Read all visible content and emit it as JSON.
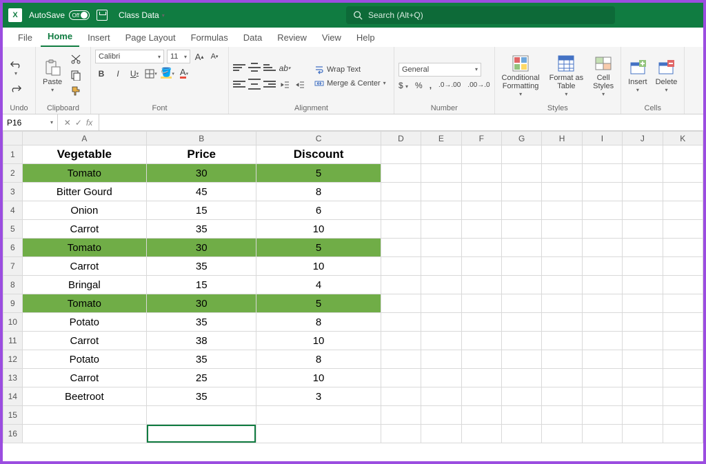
{
  "titlebar": {
    "autosave_label": "AutoSave",
    "autosave_state": "Off",
    "filename": "Class Data",
    "search_placeholder": "Search (Alt+Q)"
  },
  "menu": {
    "tabs": [
      "File",
      "Home",
      "Insert",
      "Page Layout",
      "Formulas",
      "Data",
      "Review",
      "View",
      "Help"
    ],
    "active_index": 1
  },
  "ribbon": {
    "groups": {
      "undo": "Undo",
      "clipboard": "Clipboard",
      "font": "Font",
      "alignment": "Alignment",
      "number": "Number",
      "styles": "Styles",
      "cells": "Cells"
    },
    "clipboard": {
      "paste": "Paste"
    },
    "font": {
      "name": "Calibri",
      "size": "11"
    },
    "alignment": {
      "wrap": "Wrap Text",
      "merge": "Merge & Center"
    },
    "number": {
      "format": "General"
    },
    "styles": {
      "conditional": "Conditional\nFormatting",
      "table": "Format as\nTable",
      "cell": "Cell\nStyles"
    },
    "cells": {
      "insert": "Insert",
      "delete": "Delete"
    }
  },
  "formulabar": {
    "namebox": "P16",
    "formula": ""
  },
  "grid": {
    "columns": [
      "A",
      "B",
      "C",
      "D",
      "E",
      "F",
      "G",
      "H",
      "I",
      "J",
      "K"
    ],
    "row_count": 16,
    "active_cell": {
      "row": 16,
      "col": "B"
    },
    "headers": {
      "A": "Vegetable",
      "B": "Price",
      "C": "Discount"
    },
    "rows": [
      {
        "A": "Tomato",
        "B": "30",
        "C": "5",
        "highlight": true
      },
      {
        "A": "Bitter Gourd",
        "B": "45",
        "C": "8",
        "highlight": false
      },
      {
        "A": "Onion",
        "B": "15",
        "C": "6",
        "highlight": false
      },
      {
        "A": "Carrot",
        "B": "35",
        "C": "10",
        "highlight": false
      },
      {
        "A": "Tomato",
        "B": "30",
        "C": "5",
        "highlight": true
      },
      {
        "A": "Carrot",
        "B": "35",
        "C": "10",
        "highlight": false
      },
      {
        "A": "Bringal",
        "B": "15",
        "C": "4",
        "highlight": false
      },
      {
        "A": "Tomato",
        "B": "30",
        "C": "5",
        "highlight": true
      },
      {
        "A": "Potato",
        "B": "35",
        "C": "8",
        "highlight": false
      },
      {
        "A": "Carrot",
        "B": "38",
        "C": "10",
        "highlight": false
      },
      {
        "A": "Potato",
        "B": "35",
        "C": "8",
        "highlight": false
      },
      {
        "A": "Carrot",
        "B": "25",
        "C": "10",
        "highlight": false
      },
      {
        "A": "Beetroot",
        "B": "35",
        "C": "3",
        "highlight": false
      }
    ]
  }
}
